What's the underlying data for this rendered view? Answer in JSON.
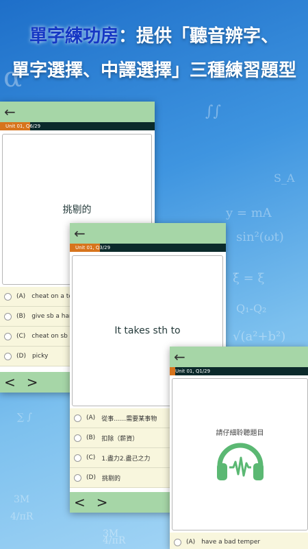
{
  "headline": {
    "line1_accent": "單字練功房",
    "line1_rest": "：提供「聽音辨字、",
    "line2": "單字選擇、中譯選擇」三種練習題型"
  },
  "colors": {
    "appbar": "#a6d6a7",
    "unitbar": "#0b2a2b",
    "progress": "#d7741c",
    "options_bg": "#f8f6dd",
    "headline_accent": "#1537c4"
  },
  "icons": {
    "back": "arrow-left",
    "prev": "chevron-left",
    "next": "chevron-right"
  },
  "back_glyph": "←",
  "prev_glyph": "<",
  "next_glyph": ">",
  "card1": {
    "unit": "Unit 01, Q6/29",
    "question": "挑剔的",
    "options": [
      {
        "letter": "(A)",
        "text": "cheat on a te"
      },
      {
        "letter": "(B)",
        "text": "give sb a han"
      },
      {
        "letter": "(C)",
        "text": "cheat on sb"
      },
      {
        "letter": "(D)",
        "text": "picky"
      }
    ]
  },
  "card2": {
    "unit": "Unit 01, Q3/29",
    "question": "It takes sth to",
    "options": [
      {
        "letter": "(A)",
        "text": "從事……需要某事物"
      },
      {
        "letter": "(B)",
        "text": "扣除（薪資）"
      },
      {
        "letter": "(C)",
        "text": "1.盡力2.盡己之力"
      },
      {
        "letter": "(D)",
        "text": "挑剔的"
      }
    ]
  },
  "card3": {
    "unit": "Unit 01, Q1/29",
    "logo_title": "請仔細聆聽題目",
    "options": [
      {
        "letter": "(A)",
        "text": "have a bad temper"
      }
    ]
  }
}
